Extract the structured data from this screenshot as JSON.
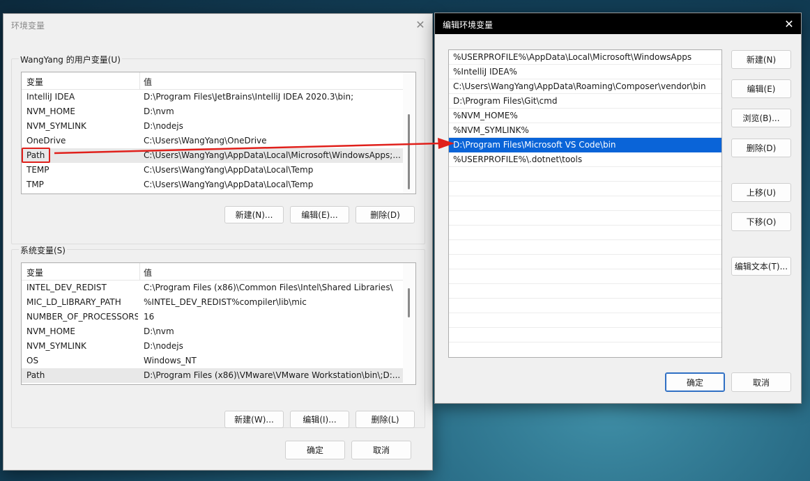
{
  "env_window": {
    "title": "环境变量",
    "user_group": {
      "label": "WangYang 的用户变量(U)",
      "columns": [
        "变量",
        "值"
      ],
      "rows": [
        {
          "name": "IntelliJ IDEA",
          "value": "D:\\Program Files\\JetBrains\\IntelliJ IDEA 2020.3\\bin;"
        },
        {
          "name": "NVM_HOME",
          "value": "D:\\nvm"
        },
        {
          "name": "NVM_SYMLINK",
          "value": "D:\\nodejs"
        },
        {
          "name": "OneDrive",
          "value": "C:\\Users\\WangYang\\OneDrive"
        },
        {
          "name": "Path",
          "value": "C:\\Users\\WangYang\\AppData\\Local\\Microsoft\\WindowsApps;..."
        },
        {
          "name": "TEMP",
          "value": "C:\\Users\\WangYang\\AppData\\Local\\Temp"
        },
        {
          "name": "TMP",
          "value": "C:\\Users\\WangYang\\AppData\\Local\\Temp"
        }
      ],
      "buttons": {
        "new": "新建(N)...",
        "edit": "编辑(E)...",
        "delete": "删除(D)"
      }
    },
    "system_group": {
      "label": "系统变量(S)",
      "columns": [
        "变量",
        "值"
      ],
      "rows": [
        {
          "name": "INTEL_DEV_REDIST",
          "value": "C:\\Program Files (x86)\\Common Files\\Intel\\Shared Libraries\\"
        },
        {
          "name": "MIC_LD_LIBRARY_PATH",
          "value": "%INTEL_DEV_REDIST%compiler\\lib\\mic"
        },
        {
          "name": "NUMBER_OF_PROCESSORS",
          "value": "16"
        },
        {
          "name": "NVM_HOME",
          "value": "D:\\nvm"
        },
        {
          "name": "NVM_SYMLINK",
          "value": "D:\\nodejs"
        },
        {
          "name": "OS",
          "value": "Windows_NT"
        },
        {
          "name": "Path",
          "value": "D:\\Program Files (x86)\\VMware\\VMware Workstation\\bin\\;D:..."
        }
      ],
      "buttons": {
        "new": "新建(W)...",
        "edit": "编辑(I)...",
        "delete": "删除(L)"
      }
    },
    "ok": "确定",
    "cancel": "取消"
  },
  "edit_window": {
    "title": "编辑环境变量",
    "entries": [
      "%USERPROFILE%\\AppData\\Local\\Microsoft\\WindowsApps",
      "%IntelliJ IDEA%",
      "C:\\Users\\WangYang\\AppData\\Roaming\\Composer\\vendor\\bin",
      "D:\\Program Files\\Git\\cmd",
      "%NVM_HOME%",
      "%NVM_SYMLINK%",
      "D:\\Program Files\\Microsoft VS Code\\bin",
      "%USERPROFILE%\\.dotnet\\tools"
    ],
    "selected_index": 6,
    "buttons": {
      "new": "新建(N)",
      "edit": "编辑(E)",
      "browse": "浏览(B)...",
      "delete": "删除(D)",
      "move_up": "上移(U)",
      "move_down": "下移(O)",
      "edit_text": "编辑文本(T)..."
    },
    "ok": "确定",
    "cancel": "取消"
  },
  "icons": {
    "close": "close-icon"
  },
  "colors": {
    "selection": "#0a64d8",
    "annotation": "#e0201b",
    "primary_border": "#2f6fc4"
  }
}
